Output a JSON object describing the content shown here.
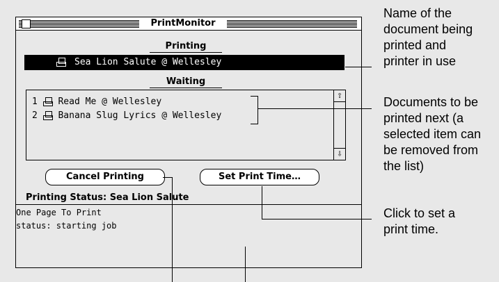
{
  "window": {
    "title": "PrintMonitor"
  },
  "printing": {
    "heading": "Printing",
    "current_item": "Sea Lion Salute @ Wellesley"
  },
  "waiting": {
    "heading": "Waiting",
    "items": [
      {
        "number": "1",
        "label": "Read Me @ Wellesley"
      },
      {
        "number": "2",
        "label": "Banana Slug Lyrics @ Wellesley"
      }
    ],
    "scroll_up": "⇧",
    "scroll_down": "⇩"
  },
  "buttons": {
    "cancel": "Cancel Printing",
    "set_time": "Set Print Time…"
  },
  "status": {
    "heading": "Printing Status: Sea Lion Salute",
    "lines": [
      "One Page To Print",
      "status: starting job"
    ]
  },
  "annotations": {
    "document_name": [
      "Name of the",
      "document being",
      "printed and",
      "printer in use"
    ],
    "documents_next": [
      "Documents to be",
      "printed next (a",
      "selected item can",
      "be removed from",
      "the list)"
    ],
    "set_time": [
      "Click to set a",
      "print time."
    ]
  }
}
